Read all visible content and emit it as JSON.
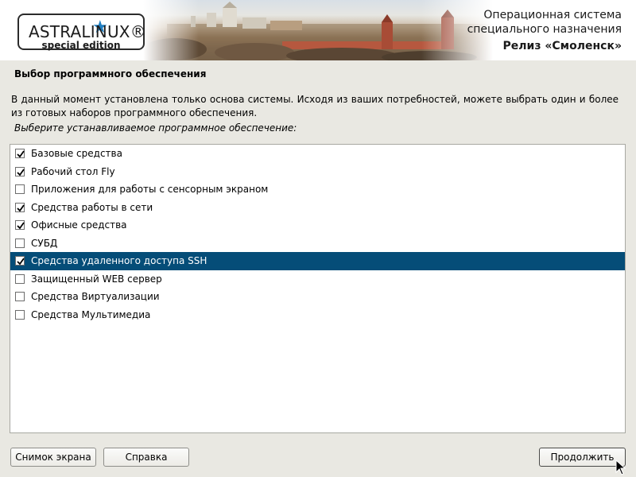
{
  "header": {
    "logo": {
      "title": "ASTRALINUX®",
      "subtitle": "special edition",
      "star_color": "#1f7ec1"
    },
    "product_line1": "Операционная система",
    "product_line2": "специального назначения",
    "release": "Релиз «Смоленск»"
  },
  "page": {
    "title": "Выбор программного обеспечения",
    "description": "В данный момент установлена только основа системы. Исходя из ваших потребностей, можете выбрать один и более из готовых наборов программного обеспечения.",
    "prompt": "Выберите устанавливаемое программное обеспечение:"
  },
  "software_list": [
    {
      "label": "Базовые средства",
      "checked": true,
      "selected": false
    },
    {
      "label": "Рабочий стол Fly",
      "checked": true,
      "selected": false
    },
    {
      "label": "Приложения для работы с сенсорным экраном",
      "checked": false,
      "selected": false
    },
    {
      "label": "Средства работы в сети",
      "checked": true,
      "selected": false
    },
    {
      "label": "Офисные средства",
      "checked": true,
      "selected": false
    },
    {
      "label": "СУБД",
      "checked": false,
      "selected": false
    },
    {
      "label": "Средства удаленного доступа SSH",
      "checked": true,
      "selected": true
    },
    {
      "label": "Защищенный WEB сервер",
      "checked": false,
      "selected": false
    },
    {
      "label": "Средства Виртуализации",
      "checked": false,
      "selected": false
    },
    {
      "label": "Средства Мультимедиа",
      "checked": false,
      "selected": false
    }
  ],
  "buttons": {
    "screenshot": "Снимок экрана",
    "help": "Справка",
    "continue": "Продолжить"
  },
  "colors": {
    "selection": "#054d78",
    "background": "#e9e8e2"
  }
}
